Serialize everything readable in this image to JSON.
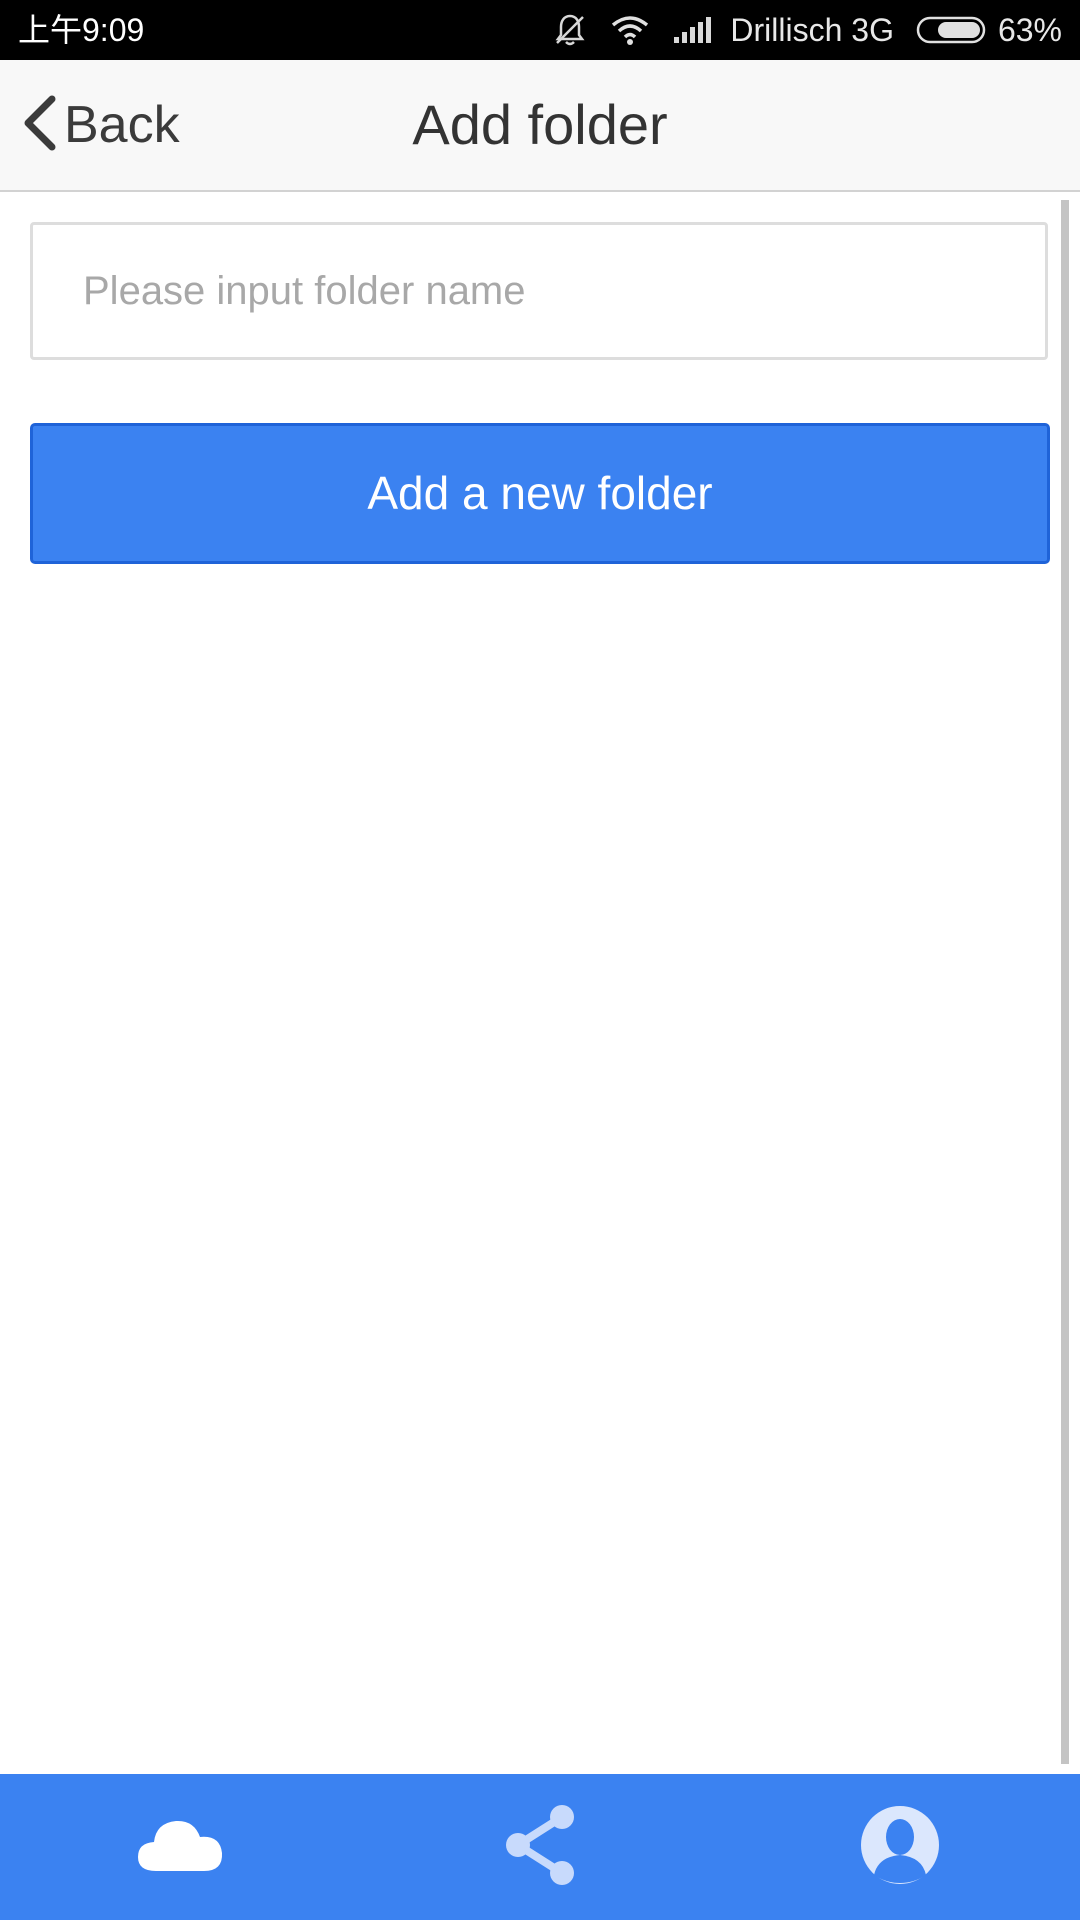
{
  "status_bar": {
    "time": "上午9:09",
    "carrier": "Drillisch 3G",
    "battery": "63%",
    "icons": [
      "bell-muted-icon",
      "wifi-icon",
      "signal-icon",
      "battery-icon"
    ]
  },
  "header": {
    "back_label": "Back",
    "title": "Add folder"
  },
  "form": {
    "folder_input_value": "",
    "folder_input_placeholder": "Please input folder name",
    "submit_label": "Add a new folder"
  },
  "tab_bar": {
    "tabs": [
      {
        "icon": "cloud-icon"
      },
      {
        "icon": "share-icon"
      },
      {
        "icon": "user-profile-icon"
      }
    ]
  },
  "colors": {
    "accent": "#3b82f1",
    "header_bg": "#f8f8f8",
    "status_bg": "#000000"
  }
}
